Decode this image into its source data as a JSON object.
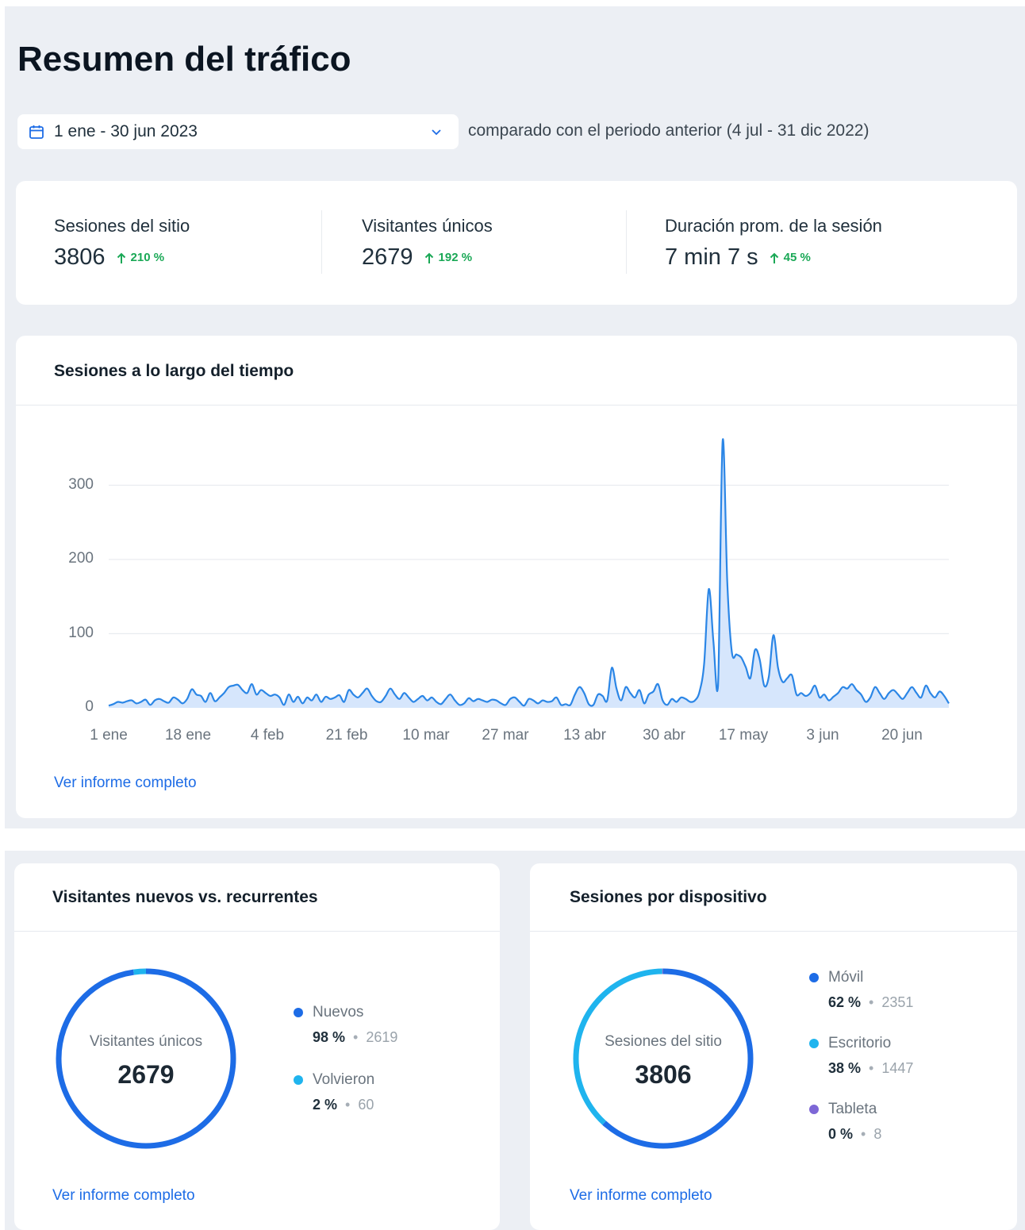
{
  "page_title": "Resumen del tráfico",
  "date_range": {
    "value": "1 ene - 30 jun 2023",
    "icon": "calendar-icon",
    "chevron": "chevron-down-icon"
  },
  "compare_text": "comparado con el periodo anterior (4 jul - 31 dic 2022)",
  "colors": {
    "accent": "#1d6ce6",
    "positive": "#1aa856",
    "light_blue": "#1fb4ee",
    "purple": "#7d67d6",
    "panel_bg": "#eceff4"
  },
  "kpis": [
    {
      "label": "Sesiones del sitio",
      "value": "3806",
      "delta": "210 %"
    },
    {
      "label": "Visitantes únicos",
      "value": "2679",
      "delta": "192 %"
    },
    {
      "label": "Duración prom. de la sesión",
      "value": "7 min 7 s",
      "delta": "45 %"
    }
  ],
  "sessions_card": {
    "title": "Sesiones a lo largo del tiempo",
    "link": "Ver informe completo"
  },
  "chart_data": {
    "type": "area",
    "title": "Sesiones a lo largo del tiempo",
    "xlabel": "",
    "ylabel": "",
    "ylim": [
      0,
      360
    ],
    "y_ticks": [
      "0",
      "100",
      "200",
      "300"
    ],
    "x_ticks": [
      "1 ene",
      "18 ene",
      "4 feb",
      "21 feb",
      "10 mar",
      "27 mar",
      "13 abr",
      "30 abr",
      "17 may",
      "3 jun",
      "20 jun"
    ],
    "x_start": "2023-01-01",
    "x_end": "2023-06-30",
    "grid": true,
    "series": [
      {
        "values": [
          3,
          5,
          8,
          7,
          9,
          10,
          6,
          8,
          11,
          4,
          10,
          12,
          9,
          7,
          14,
          11,
          6,
          12,
          25,
          18,
          16,
          8,
          20,
          9,
          14,
          20,
          28,
          30,
          31,
          24,
          20,
          32,
          18,
          24,
          20,
          16,
          18,
          14,
          4,
          18,
          8,
          15,
          6,
          14,
          10,
          18,
          8,
          15,
          12,
          14,
          17,
          8,
          24,
          18,
          14,
          20,
          26,
          16,
          9,
          8,
          16,
          26,
          18,
          12,
          20,
          14,
          8,
          12,
          16,
          10,
          14,
          8,
          5,
          12,
          18,
          10,
          4,
          6,
          13,
          9,
          12,
          10,
          8,
          11,
          10,
          6,
          4,
          12,
          14,
          8,
          3,
          12,
          10,
          6,
          10,
          8,
          9,
          14,
          4,
          5,
          4,
          18,
          28,
          20,
          5,
          4,
          18,
          16,
          10,
          54,
          26,
          10,
          28,
          20,
          14,
          24,
          6,
          18,
          22,
          32,
          10,
          4,
          12,
          8,
          14,
          12,
          8,
          10,
          22,
          60,
          160,
          90,
          30,
          360,
          170,
          75,
          72,
          68,
          55,
          40,
          78,
          66,
          30,
          42,
          98,
          54,
          35,
          40,
          44,
          18,
          20,
          16,
          20,
          30,
          14,
          18,
          10,
          15,
          20,
          28,
          26,
          32,
          24,
          18,
          8,
          14,
          28,
          20,
          12,
          20,
          24,
          18,
          12,
          20,
          28,
          20,
          14,
          30,
          20,
          14,
          22,
          16,
          6
        ]
      }
    ]
  },
  "visitors_card": {
    "title": "Visitantes nuevos vs. recurrentes",
    "center_label": "Visitantes únicos",
    "center_value": "2679",
    "link": "Ver informe completo",
    "segments": [
      {
        "name": "Nuevos",
        "pct": "98 %",
        "count": "2619",
        "fraction": 0.977,
        "color": "#1d6ce6"
      },
      {
        "name": "Volvieron",
        "pct": "2 %",
        "count": "60",
        "fraction": 0.023,
        "color": "#1fb4ee"
      }
    ]
  },
  "device_card": {
    "title": "Sesiones por dispositivo",
    "center_label": "Sesiones del sitio",
    "center_value": "3806",
    "link": "Ver informe completo",
    "segments": [
      {
        "name": "Móvil",
        "pct": "62 %",
        "count": "2351",
        "fraction": 0.618,
        "color": "#1d6ce6"
      },
      {
        "name": "Escritorio",
        "pct": "38 %",
        "count": "1447",
        "fraction": 0.38,
        "color": "#1fb4ee"
      },
      {
        "name": "Tableta",
        "pct": "0 %",
        "count": "8",
        "fraction": 0.002,
        "color": "#7d67d6"
      }
    ]
  }
}
